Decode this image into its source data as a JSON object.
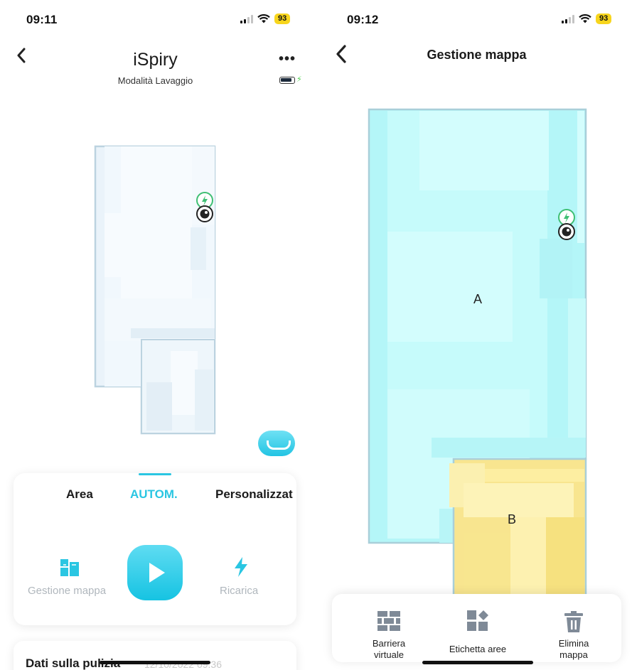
{
  "left_screen": {
    "status_time": "09:11",
    "status_battery": "93",
    "title": "iSpiry",
    "subtitle": "Modalità Lavaggio",
    "tabs": [
      "Area",
      "AUTOM.",
      "Personalizzat"
    ],
    "active_tab": "AUTOM.",
    "map_management_label": "Gestione mappa",
    "recharge_label": "Ricarica",
    "stats_title": "Dati sulla pulizia",
    "stats_time": "12/10/2022 09:36"
  },
  "right_screen": {
    "status_time": "09:12",
    "status_battery": "93",
    "title": "Gestione mappa",
    "rooms": [
      "A",
      "B"
    ],
    "tools": [
      {
        "label_line1": "Barriera",
        "label_line2": "virtuale",
        "icon": "brick-wall-icon"
      },
      {
        "label_line1": "Etichetta aree",
        "label_line2": "",
        "icon": "area-label-icon"
      },
      {
        "label_line1": "Elimina",
        "label_line2": "mappa",
        "icon": "trash-icon"
      }
    ]
  },
  "colors": {
    "accent": "#2ac6e2",
    "room_a": "#b7f7f9",
    "room_b": "#fdeea1",
    "charger_green": "#3fbf73",
    "badge_yellow": "#f7d51d"
  }
}
